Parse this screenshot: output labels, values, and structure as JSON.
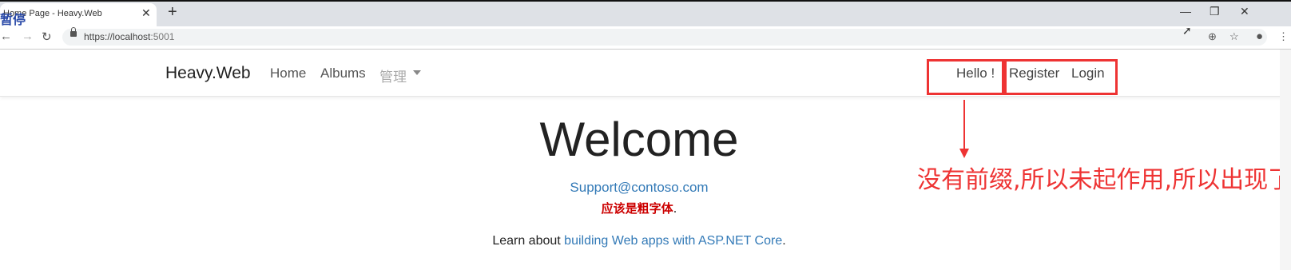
{
  "browser": {
    "tab_title": "Home Page - Heavy.Web",
    "tab_close": "✕",
    "new_tab": "+",
    "paused_label": "暂停",
    "url_host": "https://localhost",
    "url_port": ":5001",
    "window_controls": [
      "—",
      "❐",
      "✕"
    ],
    "nav_icons": [
      "back-icon",
      "forward-icon",
      "reload-icon"
    ],
    "toolbar_icons": [
      "zoom-icon",
      "star-icon",
      "profile-icon",
      "menu-icon"
    ]
  },
  "site": {
    "brand": "Heavy.Web",
    "nav": [
      "Home",
      "Albums",
      "管理"
    ],
    "hello": "Hello !",
    "register": "Register",
    "login": "Login"
  },
  "annotation": {
    "note": "没有前缀,所以未起作用,所以出现了",
    "accent_color": "#e33333"
  },
  "main": {
    "heading": "Welcome",
    "email": "Support@contoso.com",
    "bold_note": "应该是粗字体",
    "period": ".",
    "learn_prefix": "Learn about ",
    "learn_link": "building Web apps with ASP.NET Core",
    "learn_suffix": "."
  }
}
